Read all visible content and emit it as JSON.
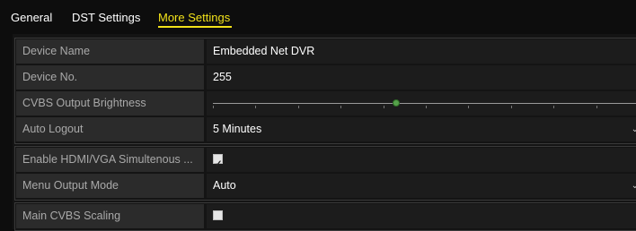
{
  "tabs": [
    {
      "label": "General",
      "active": false
    },
    {
      "label": "DST Settings",
      "active": false
    },
    {
      "label": "More Settings",
      "active": true
    }
  ],
  "fields": {
    "device_name": {
      "label": "Device Name",
      "value": "Embedded Net DVR"
    },
    "device_no": {
      "label": "Device No.",
      "value": "255"
    },
    "cvbs_brightness": {
      "label": "CVBS Output Brightness",
      "level": 0.43
    },
    "auto_logout": {
      "label": "Auto Logout",
      "value": "5 Minutes"
    },
    "hdmi_vga": {
      "label": "Enable HDMI/VGA Simultenous ...",
      "checked": true
    },
    "menu_output_mode": {
      "label": "Menu Output Mode",
      "value": "Auto"
    },
    "main_cvbs_scaling": {
      "label": "Main CVBS Scaling",
      "checked": false
    }
  },
  "colors": {
    "accent": "#f2e21a",
    "slider_thumb": "#55a14a"
  }
}
